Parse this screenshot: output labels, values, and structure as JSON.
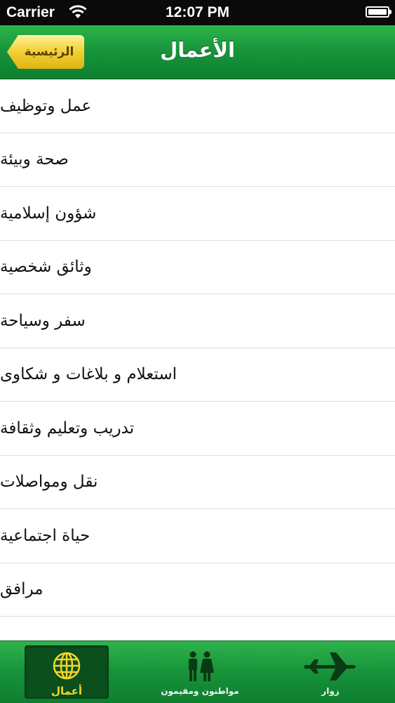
{
  "status_bar": {
    "carrier": "Carrier",
    "time": "12:07 PM"
  },
  "nav_bar": {
    "title": "الأعمال",
    "back_label": "الرئيسية"
  },
  "menu_items": [
    "عمل وتوظيف",
    "صحة وبيئة",
    "شؤون إسلامية",
    "وثائق شخصية",
    "سفر وسياحة",
    "استعلام و بلاغات و شكاوى",
    "تدريب وتعليم وثقافة",
    "نقل ومواصلات",
    "حياة اجتماعية",
    "مرافق"
  ],
  "tab_bar": {
    "tabs": [
      {
        "label": "أعمال",
        "icon": "globe-icon",
        "active": true
      },
      {
        "label": "مواطنون ومقيمون",
        "icon": "people-icon",
        "active": false
      },
      {
        "label": "زوار",
        "icon": "airplane-icon",
        "active": false
      }
    ]
  },
  "colors": {
    "bar_green": "#17933a",
    "active_tab_bg": "#0a4f1c",
    "active_tab_text": "#f6d52a",
    "back_button_yellow": "#f3d23a"
  }
}
